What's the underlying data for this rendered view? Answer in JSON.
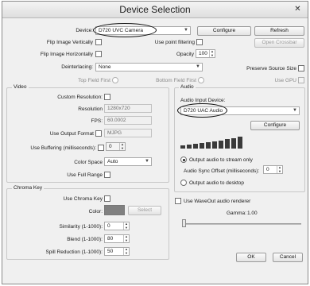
{
  "window": {
    "title": "Device Selection",
    "close_glyph": "✕"
  },
  "top": {
    "device_label": "Device:",
    "device_value": "D720 UVC Camera",
    "configure_label": "Configure",
    "refresh_label": "Refresh",
    "flip_vertical_label": "Flip Image Vertically",
    "use_point_filtering_label": "Use point filtering",
    "open_crossbar_label": "Open Crossbar",
    "flip_horizontal_label": "Flip Image Horizontally",
    "opacity_label": "Opacity",
    "opacity_value": "100",
    "deinterlacing_label": "Deinterlacing:",
    "deinterlacing_value": "None",
    "preserve_source_size_label": "Preserve Source Size",
    "top_field_first_label": "Top Field First",
    "bottom_field_first_label": "Bottom Field First",
    "use_gpu_label": "Use GPU"
  },
  "video": {
    "group_title": "Video",
    "custom_resolution_label": "Custom Resolution:",
    "resolution_label": "Resolution",
    "resolution_value": "1280x720",
    "fps_label": "FPS:",
    "fps_value": "60.0002",
    "use_output_format_label": "Use Output Format",
    "output_format_value": "MJPG",
    "use_buffering_label": "Use Buffering (milliseconds):",
    "buffering_value": "0",
    "color_space_label": "Color Space",
    "color_space_value": "Auto",
    "use_full_range_label": "Use Full Range"
  },
  "audio": {
    "group_title": "Audio",
    "input_device_label": "Audio Input Device:",
    "input_device_value": "D720 UAC Audio",
    "configure_label": "Configure",
    "output_to_stream_label": "Output audio to stream only",
    "sync_offset_label": "Audio Sync Offset (milliseconds):",
    "sync_offset_value": "0",
    "output_to_desktop_label": "Output audio to desktop"
  },
  "chroma": {
    "group_title": "Chroma Key",
    "use_chroma_key_label": "Use Chroma Key",
    "color_label": "Color:",
    "select_label": "Select",
    "similarity_label": "Similarity (1-1000):",
    "similarity_value": "0",
    "blend_label": "Blend (1-1000):",
    "blend_value": "80",
    "spill_label": "Spill Reduction (1-1000):",
    "spill_value": "50"
  },
  "wave": {
    "use_waveout_label": "Use WaveOut audio renderer",
    "gamma_label": "Gamma:",
    "gamma_value": "1.00"
  },
  "footer": {
    "ok_label": "OK",
    "cancel_label": "Cancel"
  }
}
